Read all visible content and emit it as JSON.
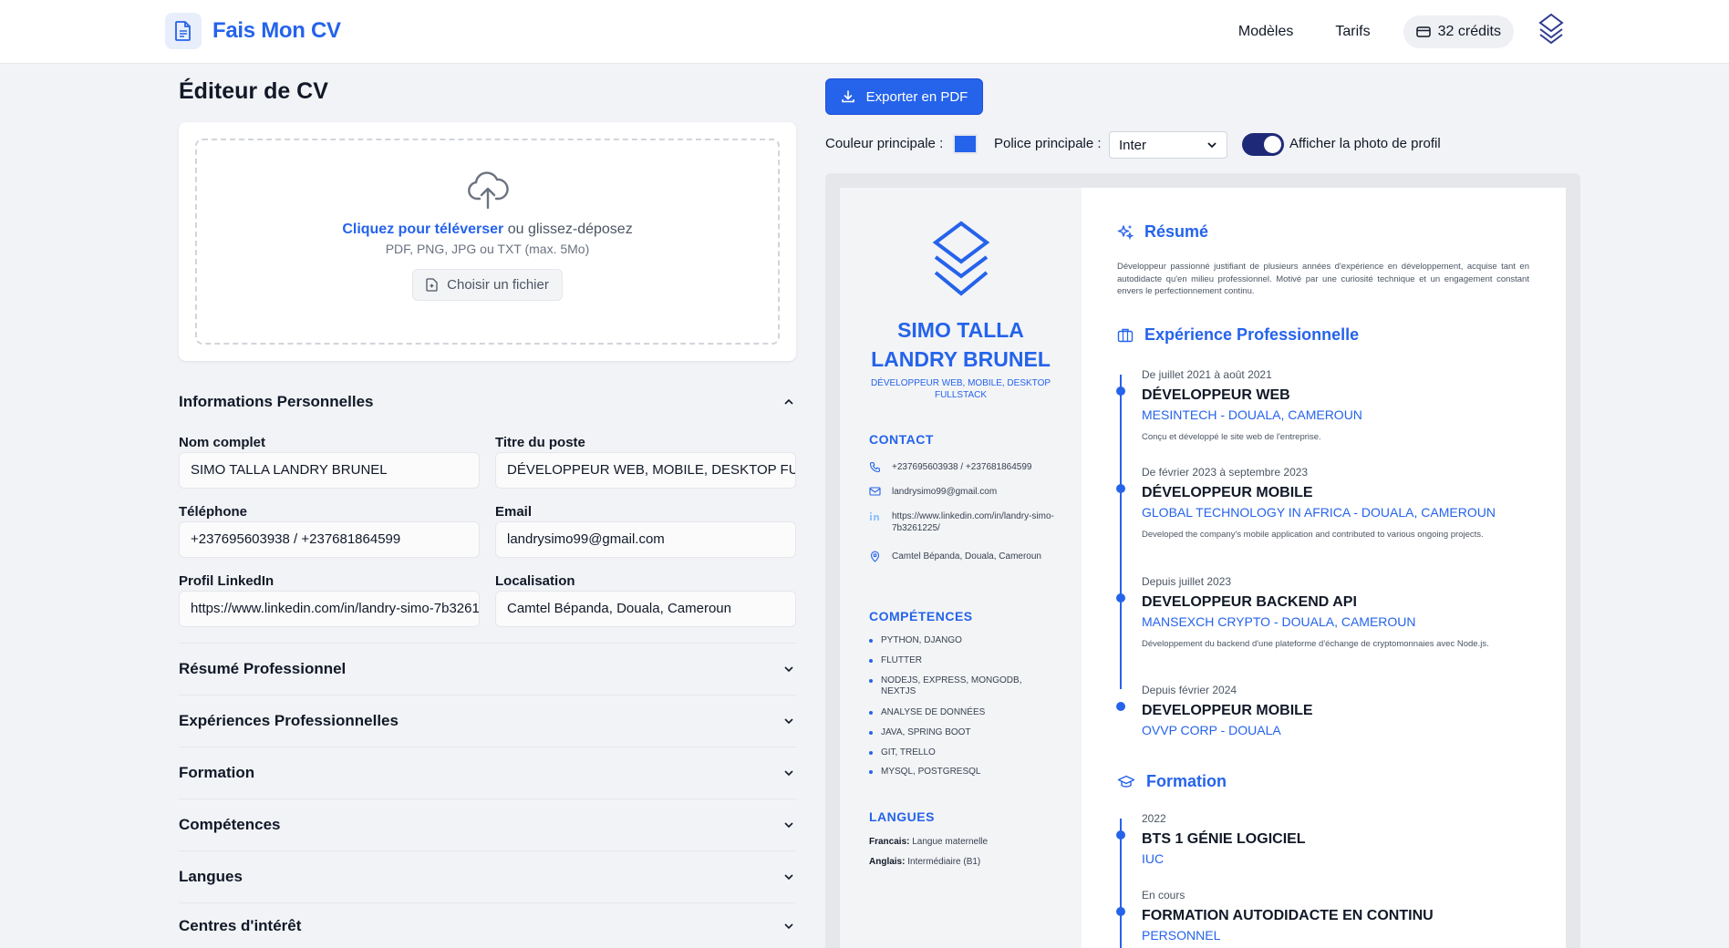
{
  "app": {
    "brand": "Fais Mon CV",
    "nav": [
      "Modèles",
      "Tarifs"
    ],
    "credits": "32 crédits"
  },
  "editor": {
    "title": "Éditeur de CV",
    "upload": {
      "click_text": "Cliquez pour téléverser",
      "or_text": "ou glissez-déposez",
      "hint": "PDF, PNG, JPG ou TXT (max. 5Mo)",
      "button": "Choisir un fichier"
    },
    "personal_section": "Informations Personnelles",
    "fields": {
      "fullname_label": "Nom complet",
      "fullname_value": "SIMO TALLA LANDRY BRUNEL",
      "jobtitle_label": "Titre du poste",
      "jobtitle_value": "DÉVELOPPEUR WEB, MOBILE, DESKTOP FULLSTACK",
      "phone_label": "Téléphone",
      "phone_value": "+237695603938 / +237681864599",
      "email_label": "Email",
      "email_value": "landrysimo99@gmail.com",
      "linkedin_label": "Profil LinkedIn",
      "linkedin_value": "https://www.linkedin.com/in/landry-simo-7b3261225/",
      "location_label": "Localisation",
      "location_value": "Camtel Bépanda, Douala, Cameroun"
    },
    "accordions": [
      "Résumé Professionnel",
      "Expériences Professionnelles",
      "Formation",
      "Compétences",
      "Langues",
      "Centres d'intérêt"
    ]
  },
  "toolbar": {
    "export_label": "Exporter en PDF",
    "color_label": "Couleur principale :",
    "primary_color": "#2563eb",
    "font_label": "Police principale :",
    "font_value": "Inter",
    "photo_label": "Afficher la photo de profil",
    "photo_enabled": true
  },
  "cv": {
    "name_line1": "SIMO TALLA",
    "name_line2": "LANDRY BRUNEL",
    "title": "DÉVELOPPEUR WEB, MOBILE, DESKTOP FULLSTACK",
    "contact_heading": "CONTACT",
    "contact": {
      "phone": "+237695603938 / +237681864599",
      "email": "landrysimo99@gmail.com",
      "linkedin": "https://www.linkedin.com/in/landry-simo-7b3261225/",
      "location": "Camtel Bépanda, Douala, Cameroun"
    },
    "skills_heading": "COMPÉTENCES",
    "skills": [
      "PYTHON, DJANGO",
      "FLUTTER",
      "NODEJS, EXPRESS, MONGODB, NEXTJS",
      "ANALYSE DE DONNÉES",
      "JAVA, SPRING BOOT",
      "GIT, TRELLO",
      "MYSQL, POSTGRESQL"
    ],
    "languages_heading": "LANGUES",
    "languages": [
      {
        "name": "Francais:",
        "level": "Langue maternelle"
      },
      {
        "name": "Anglais:",
        "level": "Intermédiaire (B1)"
      }
    ],
    "summary_heading": "Résumé",
    "summary": "Développeur passionné justifiant de plusieurs années d'expérience en développement, acquise tant en autodidacte qu'en milieu professionnel. Motivé par une curiosité technique et un engagement constant envers le perfectionnement continu.",
    "experience_heading": "Expérience Professionnelle",
    "experiences": [
      {
        "date": "De juillet 2021 à août 2021",
        "role": "DÉVELOPPEUR WEB",
        "company": "MESINTECH - DOUALA, CAMEROUN",
        "desc": "Conçu et développé le site web de l'entreprise."
      },
      {
        "date": "De février 2023 à septembre 2023",
        "role": "DÉVELOPPEUR MOBILE",
        "company": "GLOBAL TECHNOLOGY IN AFRICA - DOUALA, CAMEROUN",
        "desc": "Developed the company's mobile application and contributed to various ongoing projects."
      },
      {
        "date": "Depuis juillet 2023",
        "role": "DEVELOPPEUR BACKEND API",
        "company": "MANSEXCH CRYPTO - DOUALA, CAMEROUN",
        "desc": "Développement du backend d'une plateforme d'échange de cryptomonnaies avec Node.js."
      },
      {
        "date": "Depuis février 2024",
        "role": "DEVELOPPEUR MOBILE",
        "company": "OVVP CORP - DOUALA",
        "desc": ""
      }
    ],
    "education_heading": "Formation",
    "education": [
      {
        "date": "2022",
        "degree": "BTS 1 GÉNIE LOGICIEL",
        "school": "IUC"
      },
      {
        "date": "En cours",
        "degree": "FORMATION AUTODIDACTE EN CONTINU",
        "school": "PERSONNEL"
      }
    ]
  }
}
